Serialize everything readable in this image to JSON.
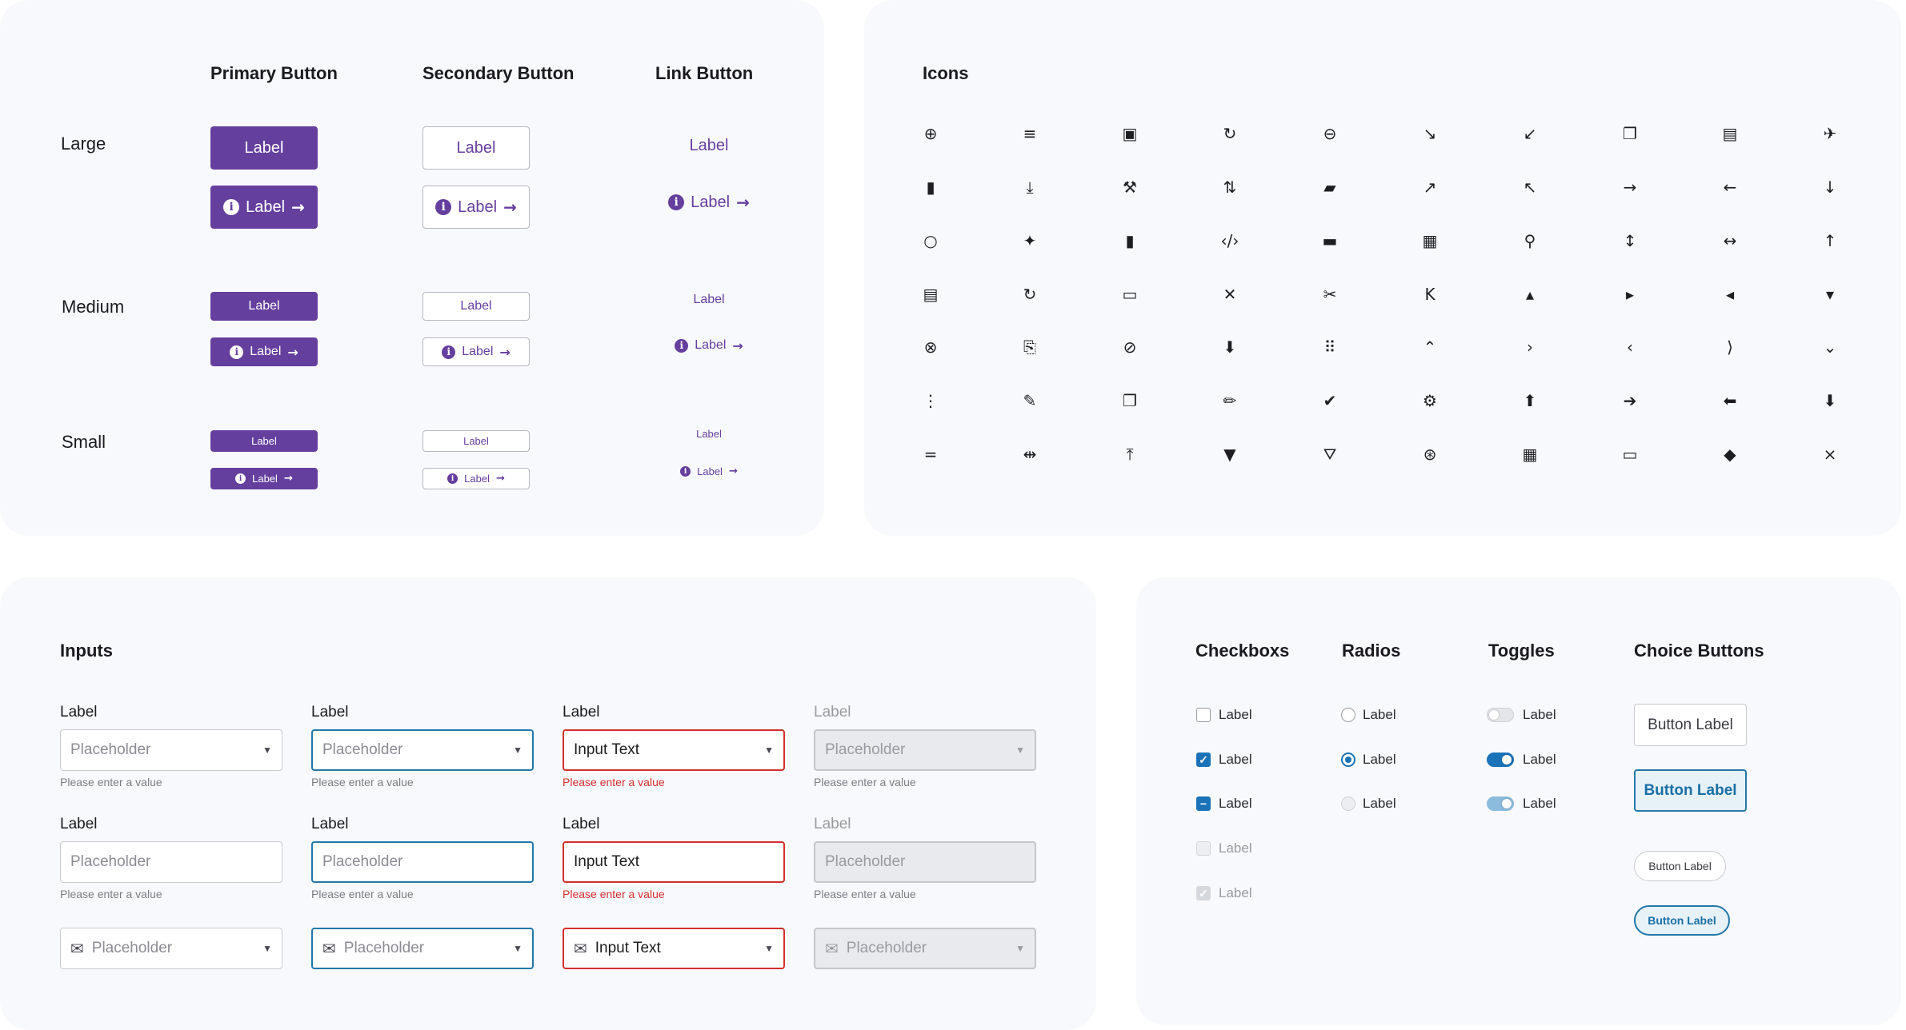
{
  "buttons": {
    "headers": {
      "primary": "Primary Button",
      "secondary": "Secondary Button",
      "link": "Link Button"
    },
    "sizes": {
      "large": "Large",
      "medium": "Medium",
      "small": "Small"
    },
    "label": "Label",
    "info_glyph": "i",
    "arrow_glyph": "→"
  },
  "icons": {
    "title": "Icons",
    "glyphs": [
      [
        "⊕",
        "≡",
        "▣",
        "↻",
        "⊖",
        "↘",
        "↙",
        "❐",
        "▤",
        "✈"
      ],
      [
        "▮",
        "⤓",
        "⚒",
        "⇅",
        "▰",
        "↗",
        "↖",
        "→",
        "←",
        "↓"
      ],
      [
        "○",
        "✦",
        "▮",
        "‹/›",
        "▬",
        "▦",
        "⚲",
        "↕",
        "↔",
        "↑"
      ],
      [
        "▤",
        "↻",
        "▭",
        "✕",
        "✂",
        "K",
        "▴",
        "▸",
        "◂",
        "▾"
      ],
      [
        "⊗",
        "⎘",
        "⊘",
        "⬇",
        "⠿",
        "⌃",
        "›",
        "‹",
        "⟩",
        "⌄"
      ],
      [
        "⋮",
        "✎",
        "❐",
        "✏",
        "✔",
        "⚙",
        "⬆",
        "➔",
        "⬅",
        "⬇"
      ],
      [
        "=",
        "⇹",
        "⤒",
        "▼",
        "⛛",
        "⊛",
        "▦",
        "▭",
        "◆",
        "⨯"
      ]
    ],
    "names": [
      [
        "add-circle",
        "add-list",
        "archive",
        "refresh-alt",
        "remove-circle",
        "arrow-down-right",
        "arrow-down-left",
        "copy-window",
        "browser",
        "airplane"
      ],
      [
        "bookmark",
        "download-tray",
        "hammer",
        "sort-up-down",
        "chat",
        "arrow-up-right",
        "arrow-up-left",
        "arrow-right",
        "arrow-left",
        "arrow-down"
      ],
      [
        "circle",
        "sparkle",
        "clipboard",
        "code",
        "comment",
        "calendar",
        "pin-user",
        "expand-vertical",
        "expand-horizontal",
        "arrow-up"
      ],
      [
        "columns",
        "check-circle",
        "credit-card",
        "close",
        "scissors",
        "collapse-left",
        "caret-up",
        "caret-right",
        "caret-left",
        "caret-down"
      ],
      [
        "close-circle",
        "document",
        "block",
        "download-circle",
        "drag-horizontal",
        "chevron-up",
        "chevron-right",
        "chevron-left",
        "collapse-right",
        "chevron-down"
      ],
      [
        "drag-vertical",
        "edit-alt",
        "duplicate",
        "pencil",
        "verified",
        "settings",
        "up-circle",
        "right-circle",
        "left-circle",
        "down-circle"
      ],
      [
        "equals",
        "swap",
        "upload",
        "filter",
        "filter-check",
        "dashboard",
        "layout",
        "terminal",
        "pen-nib",
        "collapse-all"
      ]
    ]
  },
  "inputs": {
    "title": "Inputs",
    "label": "Label",
    "placeholder": "Placeholder",
    "input_text": "Input Text",
    "help": "Please enter a value",
    "caret": "▼",
    "mail": "✉"
  },
  "choices": {
    "headers": {
      "checkbox": "Checkboxs",
      "radio": "Radios",
      "toggle": "Toggles",
      "choice": "Choice Buttons"
    },
    "label": "Label",
    "check": "✓",
    "minus": "−",
    "button_label": "Button Label"
  }
}
